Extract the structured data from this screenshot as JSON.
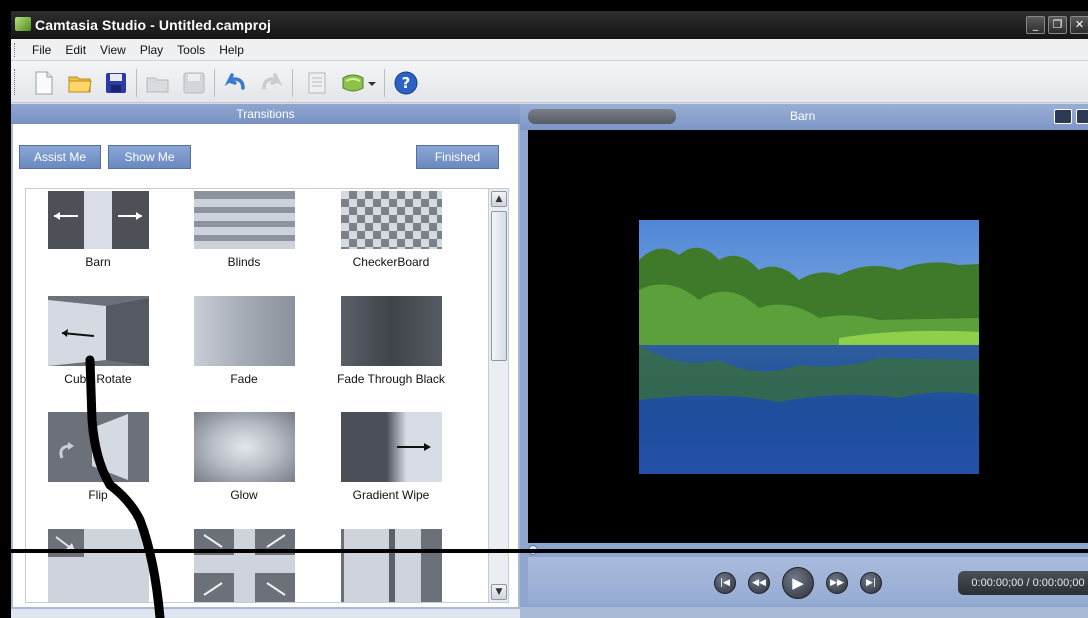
{
  "window": {
    "title": "Camtasia Studio - Untitled.camproj",
    "minimize_glyph": "_",
    "restore_glyph": "❐",
    "close_glyph": "✕"
  },
  "menu": [
    "File",
    "Edit",
    "View",
    "Play",
    "Tools",
    "Help"
  ],
  "toolbar": {
    "icons": [
      "new-file-icon",
      "open-folder-icon",
      "save-icon",
      "open-folder-disabled-icon",
      "save-disabled-icon",
      "undo-icon",
      "redo-disabled-icon",
      "checklist-icon",
      "produce-icon",
      "dropdown-arrow-icon",
      "help-icon"
    ]
  },
  "transitions": {
    "header": "Transitions",
    "assist_label": "Assist Me",
    "show_label": "Show Me",
    "finished_label": "Finished",
    "items": [
      "Barn",
      "Blinds",
      "CheckerBoard",
      "Cube Rotate",
      "Fade",
      "Fade Through Black",
      "Flip",
      "Glow",
      "Gradient Wipe"
    ]
  },
  "preview": {
    "title": "Barn",
    "time": "0:00:00;00 / 0:00:00;00",
    "playback_position": 0
  },
  "colors": {
    "panel_blue": "#7791c2",
    "button_blue": "#6b89c0",
    "title_bar": "#1b1b1b"
  }
}
